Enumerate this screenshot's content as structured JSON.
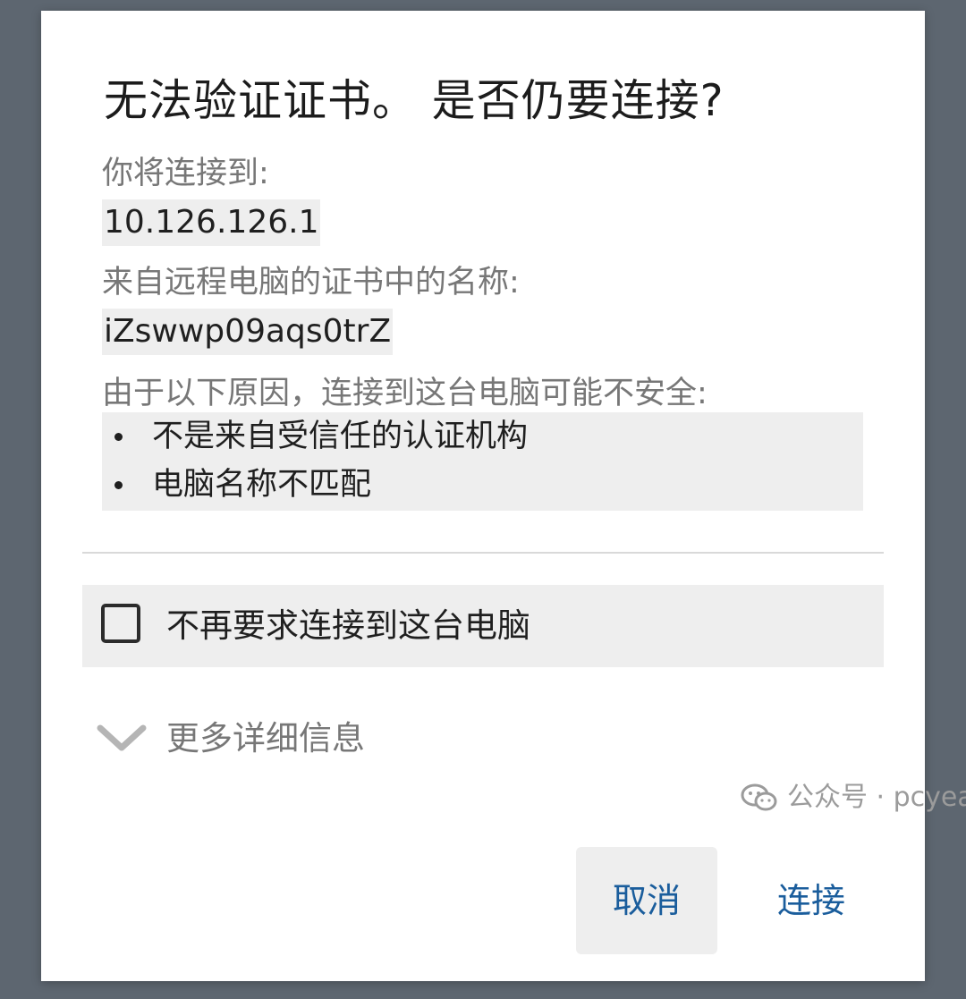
{
  "dialog": {
    "title": "无法验证证书。 是否仍要连接?",
    "connect_label": "你将连接到:",
    "host": "10.126.126.1",
    "cert_name_label": "来自远程电脑的证书中的名称:",
    "cert_name": "iZswwp09aqs0trZ",
    "reasons_label": "由于以下原因，连接到这台电脑可能不安全:",
    "reasons": [
      "不是来自受信任的认证机构",
      "电脑名称不匹配"
    ],
    "dont_ask_label": "不再要求连接到这台电脑",
    "dont_ask_checked": false,
    "more_details_label": "更多详细信息",
    "cancel_label": "取消",
    "connect_button_label": "连接"
  },
  "watermark": {
    "text": "公众号 · pcyear"
  },
  "colors": {
    "backdrop": "#5d6670",
    "dialog_bg": "#ffffff",
    "accent": "#1a5d9c",
    "muted_text": "#777777",
    "highlight_bg": "#eeeeee"
  },
  "icons": {
    "checkbox": "checkbox-unchecked-icon",
    "expand": "chevron-down-icon",
    "watermark_logo": "wechat-icon"
  }
}
